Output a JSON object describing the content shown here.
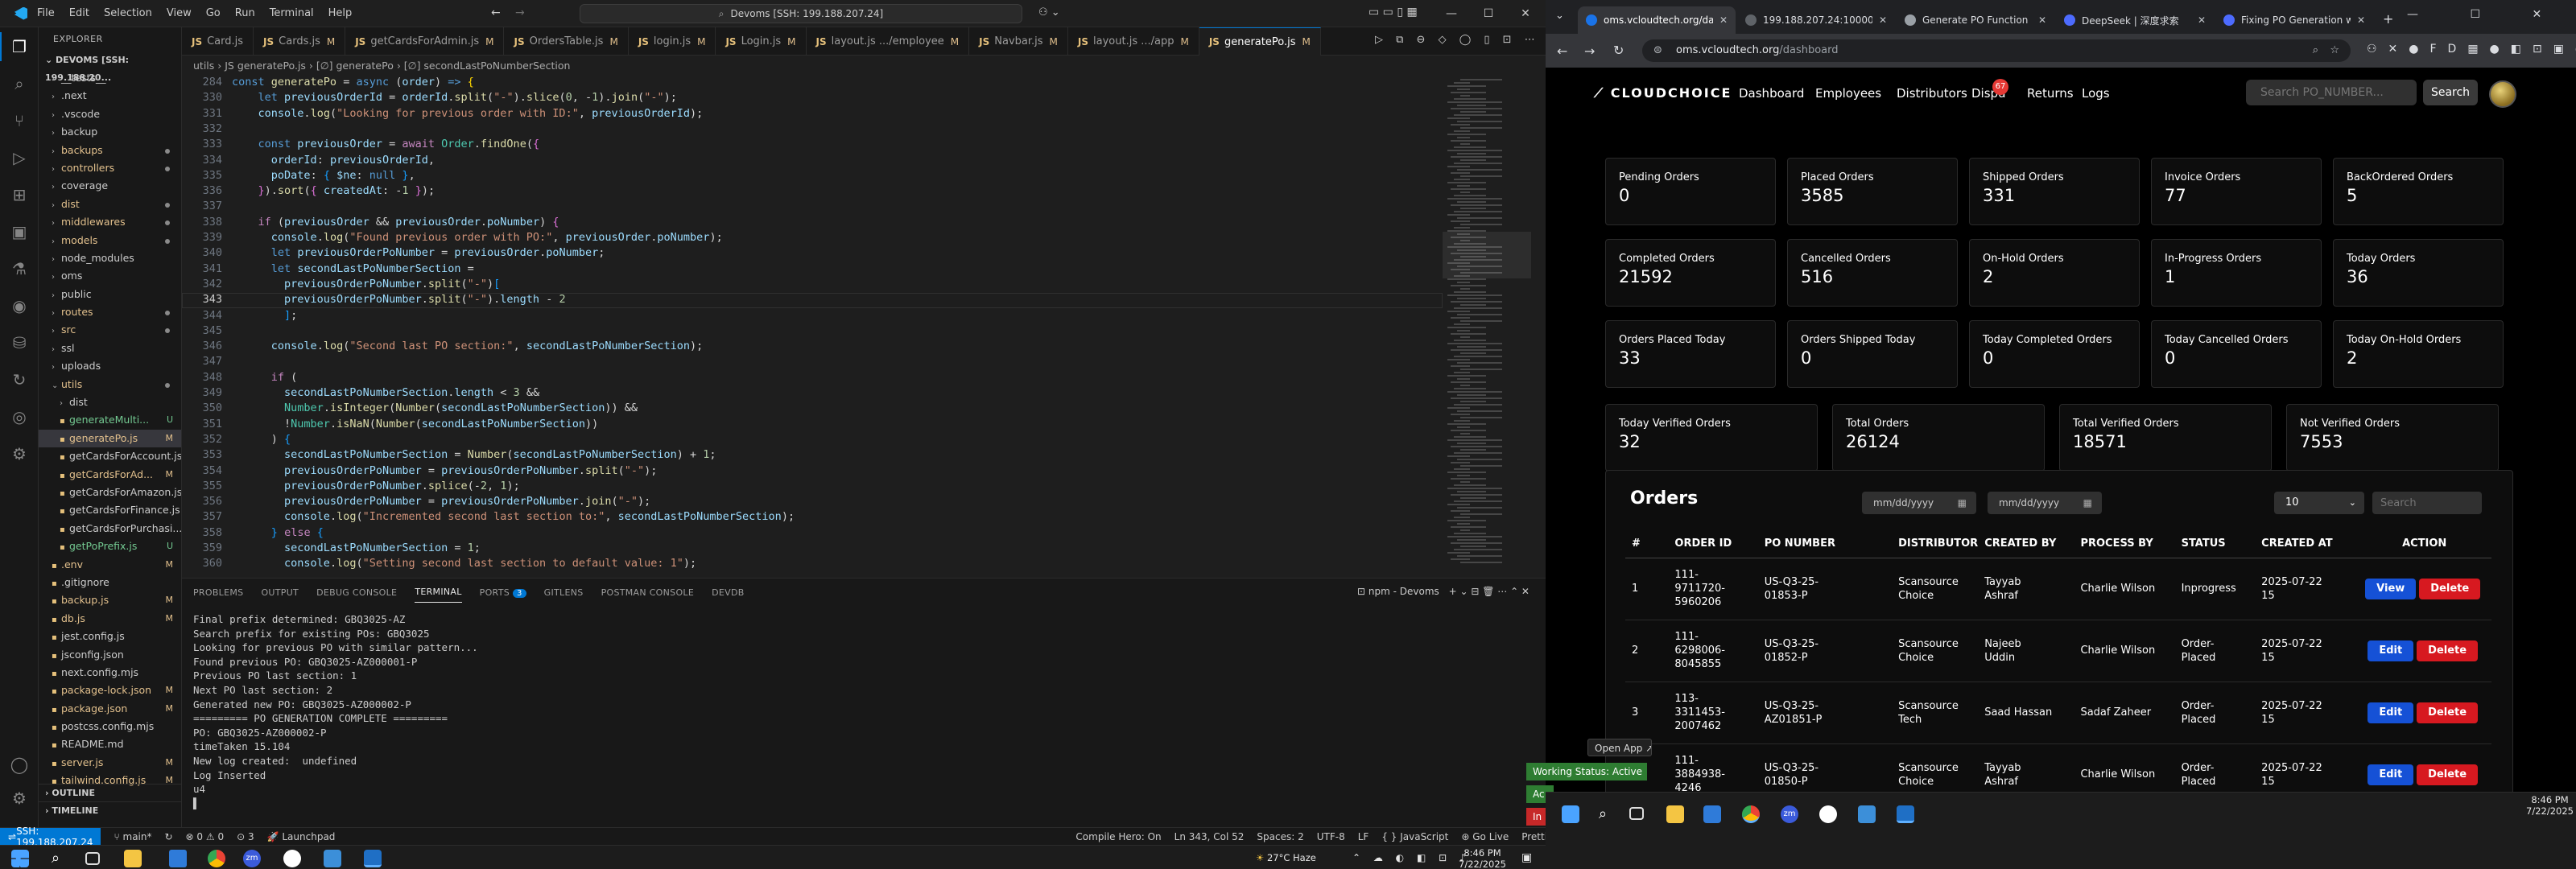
{
  "vscode": {
    "menu": [
      "File",
      "Edit",
      "Selection",
      "View",
      "Go",
      "Run",
      "Terminal",
      "Help"
    ],
    "command_center": "Devoms [SSH: 199.188.207.24]",
    "explorer_title": "EXPLORER",
    "root_folder": "DEVOMS [SSH: 199.188.20...",
    "tree": [
      {
        "label": "__tests__",
        "indent": 1,
        "chev": "›"
      },
      {
        "label": ".next",
        "indent": 1,
        "chev": "›"
      },
      {
        "label": ".vscode",
        "indent": 1,
        "chev": "›"
      },
      {
        "label": "backup",
        "indent": 1,
        "chev": "›"
      },
      {
        "label": "backups",
        "indent": 1,
        "chev": "›",
        "dot": true,
        "cls": "mod"
      },
      {
        "label": "controllers",
        "indent": 1,
        "chev": "›",
        "dot": true,
        "cls": "mod"
      },
      {
        "label": "coverage",
        "indent": 1,
        "chev": "›"
      },
      {
        "label": "dist",
        "indent": 1,
        "chev": "›",
        "dot": true,
        "cls": "mod"
      },
      {
        "label": "middlewares",
        "indent": 1,
        "chev": "›",
        "dot": true,
        "cls": "mod"
      },
      {
        "label": "models",
        "indent": 1,
        "chev": "›",
        "dot": true,
        "cls": "mod"
      },
      {
        "label": "node_modules",
        "indent": 1,
        "chev": "›"
      },
      {
        "label": "oms",
        "indent": 1,
        "chev": "›"
      },
      {
        "label": "public",
        "indent": 1,
        "chev": "›"
      },
      {
        "label": "routes",
        "indent": 1,
        "chev": "›",
        "dot": true,
        "cls": "mod"
      },
      {
        "label": "src",
        "indent": 1,
        "chev": "›",
        "dot": true,
        "cls": "mod"
      },
      {
        "label": "ssl",
        "indent": 1,
        "chev": "›"
      },
      {
        "label": "uploads",
        "indent": 1,
        "chev": "›"
      },
      {
        "label": "utils",
        "indent": 1,
        "chev": "⌄",
        "dot": true,
        "cls": "mod"
      },
      {
        "label": "dist",
        "indent": 2,
        "chev": "›"
      },
      {
        "label": "generateMulti...",
        "indent": 2,
        "badge": "U",
        "cls": "untr"
      },
      {
        "label": "generatePo.js",
        "indent": 2,
        "badge": "M",
        "cls": "mod",
        "sel": true
      },
      {
        "label": "getCardsForAccount.js",
        "indent": 2
      },
      {
        "label": "getCardsForAd...",
        "indent": 2,
        "badge": "M",
        "cls": "mod"
      },
      {
        "label": "getCardsForAmazon.js",
        "indent": 2
      },
      {
        "label": "getCardsForFinance.js",
        "indent": 2
      },
      {
        "label": "getCardsForPurchasi...",
        "indent": 2
      },
      {
        "label": "getPoPrefix.js",
        "indent": 2,
        "badge": "U",
        "cls": "untr"
      },
      {
        "label": ".env",
        "indent": 1,
        "badge": "M",
        "cls": "mod"
      },
      {
        "label": ".gitignore",
        "indent": 1
      },
      {
        "label": "backup.js",
        "indent": 1,
        "badge": "M",
        "cls": "mod"
      },
      {
        "label": "db.js",
        "indent": 1,
        "badge": "M",
        "cls": "mod"
      },
      {
        "label": "jest.config.js",
        "indent": 1
      },
      {
        "label": "jsconfig.json",
        "indent": 1
      },
      {
        "label": "next.config.mjs",
        "indent": 1
      },
      {
        "label": "package-lock.json",
        "indent": 1,
        "badge": "M",
        "cls": "mod"
      },
      {
        "label": "package.json",
        "indent": 1,
        "badge": "M",
        "cls": "mod"
      },
      {
        "label": "postcss.config.mjs",
        "indent": 1
      },
      {
        "label": "README.md",
        "indent": 1
      },
      {
        "label": "server.js",
        "indent": 1,
        "badge": "M",
        "cls": "mod"
      },
      {
        "label": "tailwind.config.js",
        "indent": 1,
        "badge": "M",
        "cls": "mod"
      }
    ],
    "outline": "OUTLINE",
    "timeline": "TIMELINE",
    "tabs": [
      {
        "name": "Card.js",
        "m": ""
      },
      {
        "name": "Cards.js",
        "m": "M"
      },
      {
        "name": "getCardsForAdmin.js",
        "m": "M"
      },
      {
        "name": "OrdersTable.js",
        "m": "M"
      },
      {
        "name": "login.js",
        "m": "M"
      },
      {
        "name": "Login.js",
        "m": "M"
      },
      {
        "name": "layout.js .../employee",
        "m": "M"
      },
      {
        "name": "Navbar.js",
        "m": "M"
      },
      {
        "name": "layout.js .../app",
        "m": "M"
      },
      {
        "name": "generatePo.js",
        "m": "M",
        "active": true
      }
    ],
    "breadcrumb": "utils  ›  JS generatePo.js  ›  [∅] generatePo  ›  [∅] secondLastPoNumberSection",
    "code": [
      {
        "n": "284",
        "h": "<span class=\"c2\">const</span> <span class=\"f\">generatePo</span> = <span class=\"c2\">async</span> (<span class=\"v\">order</span>) <span class=\"c2\">=&gt;</span> <span class=\"p\">{</span>"
      },
      {
        "n": "330",
        "h": "    <span class=\"c2\">let</span> <span class=\"v\">previousOrderId</span> = <span class=\"v\">orderId</span>.<span class=\"f\">split</span>(<span class=\"s\">\"-\"</span>).<span class=\"f\">slice</span>(<span class=\"n\">0</span>, -<span class=\"n\">1</span>).<span class=\"f\">join</span>(<span class=\"s\">\"-\"</span>);"
      },
      {
        "n": "331",
        "h": "    <span class=\"v\">console</span>.<span class=\"f\">log</span>(<span class=\"s\">\"Looking for previous order with ID:\"</span>, <span class=\"v\">previousOrderId</span>);"
      },
      {
        "n": "332",
        "h": ""
      },
      {
        "n": "333",
        "h": "    <span class=\"c2\">const</span> <span class=\"v\">previousOrder</span> = <span class=\"k\">await</span> <span class=\"cls\">Order</span>.<span class=\"f\">findOne</span>(<span class=\"p2\">{</span>"
      },
      {
        "n": "334",
        "h": "      <span class=\"v\">orderId</span>: <span class=\"v\">previousOrderId</span>,"
      },
      {
        "n": "335",
        "h": "      <span class=\"v\">poDate</span>: <span class=\"p3\">{</span> <span class=\"v\">$ne</span>: <span class=\"c2\">null</span> <span class=\"p3\">}</span>,"
      },
      {
        "n": "336",
        "h": "    <span class=\"p2\">}</span>).<span class=\"f\">sort</span>(<span class=\"p2\">{</span> <span class=\"v\">createdAt</span>: -<span class=\"n\">1</span> <span class=\"p2\">}</span>);"
      },
      {
        "n": "337",
        "h": ""
      },
      {
        "n": "338",
        "h": "    <span class=\"k\">if</span> (<span class=\"v\">previousOrder</span> &amp;&amp; <span class=\"v\">previousOrder</span>.<span class=\"v\">poNumber</span>) <span class=\"p2\">{</span>"
      },
      {
        "n": "339",
        "h": "      <span class=\"v\">console</span>.<span class=\"f\">log</span>(<span class=\"s\">\"Found previous order with PO:\"</span>, <span class=\"v\">previousOrder</span>.<span class=\"v\">poNumber</span>);"
      },
      {
        "n": "340",
        "h": "      <span class=\"c2\">let</span> <span class=\"v\">previousOrderPoNumber</span> = <span class=\"v\">previousOrder</span>.<span class=\"v\">poNumber</span>;"
      },
      {
        "n": "341",
        "h": "      <span class=\"c2\">let</span> <span class=\"v\">secondLastPoNumberSection</span> ="
      },
      {
        "n": "342",
        "h": "        <span class=\"v\">previousOrderPoNumber</span>.<span class=\"f\">split</span>(<span class=\"s\">\"-\"</span>)<span class=\"p3\">[</span>"
      },
      {
        "n": "343",
        "h": "        <span class=\"v\">previousOrderPoNumber</span>.<span class=\"f\">split</span>(<span class=\"s\">\"-\"</span>).<span class=\"v\">length</span> - <span class=\"n\">2</span>",
        "cur": true
      },
      {
        "n": "344",
        "h": "        <span class=\"p3\">]</span>;"
      },
      {
        "n": "345",
        "h": ""
      },
      {
        "n": "346",
        "h": "      <span class=\"v\">console</span>.<span class=\"f\">log</span>(<span class=\"s\">\"Second last PO section:\"</span>, <span class=\"v\">secondLastPoNumberSection</span>);"
      },
      {
        "n": "347",
        "h": ""
      },
      {
        "n": "348",
        "h": "      <span class=\"k\">if</span> ("
      },
      {
        "n": "349",
        "h": "        <span class=\"v\">secondLastPoNumberSection</span>.<span class=\"v\">length</span> &lt; <span class=\"n\">3</span> &amp;&amp;"
      },
      {
        "n": "350",
        "h": "        <span class=\"cls\">Number</span>.<span class=\"f\">isInteger</span>(<span class=\"f\">Number</span>(<span class=\"v\">secondLastPoNumberSection</span>)) &amp;&amp;"
      },
      {
        "n": "351",
        "h": "        !<span class=\"cls\">Number</span>.<span class=\"f\">isNaN</span>(<span class=\"f\">Number</span>(<span class=\"v\">secondLastPoNumberSection</span>))"
      },
      {
        "n": "352",
        "h": "      ) <span class=\"p3\">{</span>"
      },
      {
        "n": "353",
        "h": "        <span class=\"v\">secondLastPoNumberSection</span> = <span class=\"f\">Number</span>(<span class=\"v\">secondLastPoNumberSection</span>) + <span class=\"n\">1</span>;"
      },
      {
        "n": "354",
        "h": "        <span class=\"v\">previousOrderPoNumber</span> = <span class=\"v\">previousOrderPoNumber</span>.<span class=\"f\">split</span>(<span class=\"s\">\"-\"</span>);"
      },
      {
        "n": "355",
        "h": "        <span class=\"v\">previousOrderPoNumber</span>.<span class=\"f\">splice</span>(-<span class=\"n\">2</span>, <span class=\"n\">1</span>);"
      },
      {
        "n": "356",
        "h": "        <span class=\"v\">previousOrderPoNumber</span> = <span class=\"v\">previousOrderPoNumber</span>.<span class=\"f\">join</span>(<span class=\"s\">\"-\"</span>);"
      },
      {
        "n": "357",
        "h": "        <span class=\"v\">console</span>.<span class=\"f\">log</span>(<span class=\"s\">\"Incremented second last section to:\"</span>, <span class=\"v\">secondLastPoNumberSection</span>);"
      },
      {
        "n": "358",
        "h": "      <span class=\"p3\">}</span> <span class=\"k\">else</span> <span class=\"p3\">{</span>"
      },
      {
        "n": "359",
        "h": "        <span class=\"v\">secondLastPoNumberSection</span> = <span class=\"n\">1</span>;"
      },
      {
        "n": "360",
        "h": "        <span class=\"v\">console</span>.<span class=\"f\">log</span>(<span class=\"s\">\"Setting second last section to default value: 1\"</span>);"
      }
    ],
    "panel_tabs": [
      "PROBLEMS",
      "OUTPUT",
      "DEBUG CONSOLE",
      "TERMINAL",
      "PORTS",
      "GITLENS",
      "POSTMAN CONSOLE",
      "DEVDB"
    ],
    "ports_count": "3",
    "terminal_name": "npm - Devoms",
    "terminal_lines": [
      "Final prefix determined: GBQ3025-AZ",
      "Search prefix for existing POs: GBQ3025",
      "Looking for previous PO with similar pattern...",
      "Found previous PO: GBQ3025-AZ000001-P",
      "Previous PO last section: 1",
      "Next PO last section: 2",
      "Generated new PO: GBQ3025-AZ000002-P",
      "========= PO GENERATION COMPLETE =========",
      "PO: GBQ3025-AZ000002-P",
      "timeTaken 15.104",
      "New log created:  undefined",
      "Log Inserted",
      "u4",
      "▌"
    ],
    "status": {
      "remote": "SSH: 199.188.207.24",
      "branch": "main*",
      "errors": "0",
      "warnings": "0",
      "problems": "3",
      "launchpad": "Launchpad",
      "compile": "Compile Hero: On",
      "position": "Ln 343, Col 52",
      "spaces": "Spaces: 2",
      "encoding": "UTF-8",
      "eol": "LF",
      "lang": "JavaScript",
      "golive": "Go Live",
      "prettier": "Prettier"
    }
  },
  "taskbar_left": {
    "weather": "27°C  Haze",
    "time": "8:46 PM",
    "date": "7/22/2025"
  },
  "taskbar_right": {
    "time": "8:46 PM",
    "date": "7/22/2025"
  },
  "chrome": {
    "tabs": [
      {
        "title": "oms.vcloudtech.org/da",
        "color": "#1a73e8",
        "active": true
      },
      {
        "title": "199.188.207.24:10000/c",
        "color": "#5f6368"
      },
      {
        "title": "Generate PO Function Re",
        "color": "#9aa0a6"
      },
      {
        "title": "DeepSeek | 深度求索",
        "color": "#4d6bfe"
      },
      {
        "title": "Fixing PO Generation wi",
        "color": "#4d6bfe"
      }
    ],
    "url_host": "oms.vcloudtech.org",
    "url_path": "/dashboard"
  },
  "app": {
    "brand": "CLOUDCHOICE",
    "nav": [
      "Dashboard",
      "Employees",
      "Distributors",
      "Dispu",
      "Returns",
      "Logs"
    ],
    "notif_count": "67",
    "search_placeholder": "Search PO_NUMBER...",
    "search_btn": "Search",
    "cards": [
      {
        "label": "Pending Orders",
        "value": "0"
      },
      {
        "label": "Placed Orders",
        "value": "3585"
      },
      {
        "label": "Shipped Orders",
        "value": "331"
      },
      {
        "label": "Invoice Orders",
        "value": "77"
      },
      {
        "label": "BackOrdered Orders",
        "value": "5"
      },
      {
        "label": "Completed Orders",
        "value": "21592"
      },
      {
        "label": "Cancelled Orders",
        "value": "516"
      },
      {
        "label": "On-Hold Orders",
        "value": "2"
      },
      {
        "label": "In-Progress Orders",
        "value": "1"
      },
      {
        "label": "Today Orders",
        "value": "36"
      },
      {
        "label": "Orders Placed Today",
        "value": "33"
      },
      {
        "label": "Orders Shipped Today",
        "value": "0"
      },
      {
        "label": "Today Completed Orders",
        "value": "0"
      },
      {
        "label": "Today Cancelled Orders",
        "value": "0"
      },
      {
        "label": "Today On-Hold Orders",
        "value": "2"
      },
      {
        "label": "Today Verified Orders",
        "value": "32"
      },
      {
        "label": "Total Orders",
        "value": "26124"
      },
      {
        "label": "Total Verified Orders",
        "value": "18571"
      },
      {
        "label": "Not Verified Orders",
        "value": "7553"
      }
    ],
    "orders_title": "Orders",
    "date_placeholder": "mm/dd/yyyy",
    "page_size": "10",
    "table_search_placeholder": "Search",
    "columns": [
      "#",
      "ORDER ID",
      "PO NUMBER",
      "DISTRIBUTOR",
      "CREATED BY",
      "PROCESS BY",
      "STATUS",
      "CREATED AT",
      "ACTION"
    ],
    "rows": [
      {
        "idx": "1",
        "order_id": "111-\n9711720-\n5960206",
        "po": "US-Q3-25-\n01853-P",
        "dist": "Scansource\nChoice",
        "created_by": "Tayyab\nAshraf",
        "process_by": "Charlie Wilson",
        "status": "Inprogress",
        "created_at": "2025-07-22\n15",
        "actions": [
          "View",
          "Delete"
        ]
      },
      {
        "idx": "2",
        "order_id": "111-\n6298006-\n8045855",
        "po": "US-Q3-25-\n01852-P",
        "dist": "Scansource\nChoice",
        "created_by": "Najeeb\nUddin",
        "process_by": "Charlie Wilson",
        "status": "Order-\nPlaced",
        "created_at": "2025-07-22\n15",
        "actions": [
          "Edit",
          "Delete"
        ]
      },
      {
        "idx": "3",
        "order_id": "113-\n3311453-\n2007462",
        "po": "US-Q3-25-\nAZ01851-P",
        "dist": "Scansource\nTech",
        "created_by": "Saad Hassan",
        "process_by": "Sadaf Zaheer",
        "status": "Order-\nPlaced",
        "created_at": "2025-07-22\n15",
        "actions": [
          "Edit",
          "Delete"
        ]
      },
      {
        "idx": "4",
        "order_id": "111-\n3884938-\n4246",
        "po": "US-Q3-25-\n01850-P",
        "dist": "Scansource\nChoice",
        "created_by": "Tayyab\nAshraf",
        "process_by": "Charlie Wilson",
        "status": "Order-\nPlaced",
        "created_at": "2025-07-22\n15",
        "actions": [
          "Edit",
          "Delete"
        ]
      }
    ]
  },
  "overlays": {
    "open_app": "Open App ↗",
    "working_status": "Working Status: Active",
    "toast2": "Ac",
    "toast3": "In"
  }
}
